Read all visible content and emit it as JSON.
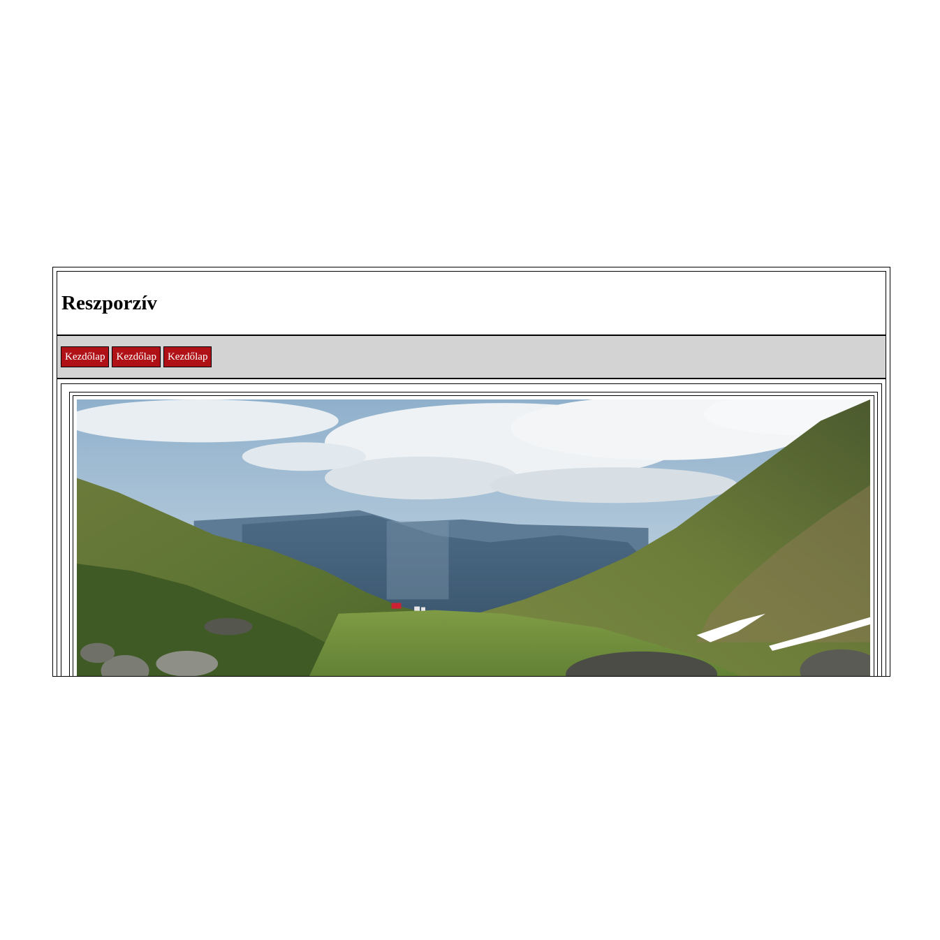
{
  "header": {
    "title": "Reszporzív"
  },
  "nav": {
    "items": [
      {
        "label": "Kezdőlap"
      },
      {
        "label": "Kezdőlap"
      },
      {
        "label": "Kezdőlap"
      }
    ]
  },
  "main": {
    "image_alt": "mountain-valley-photo"
  },
  "colors": {
    "nav_background": "#d3d3d3",
    "button_background": "#b01116",
    "button_text": "#ffffff"
  }
}
